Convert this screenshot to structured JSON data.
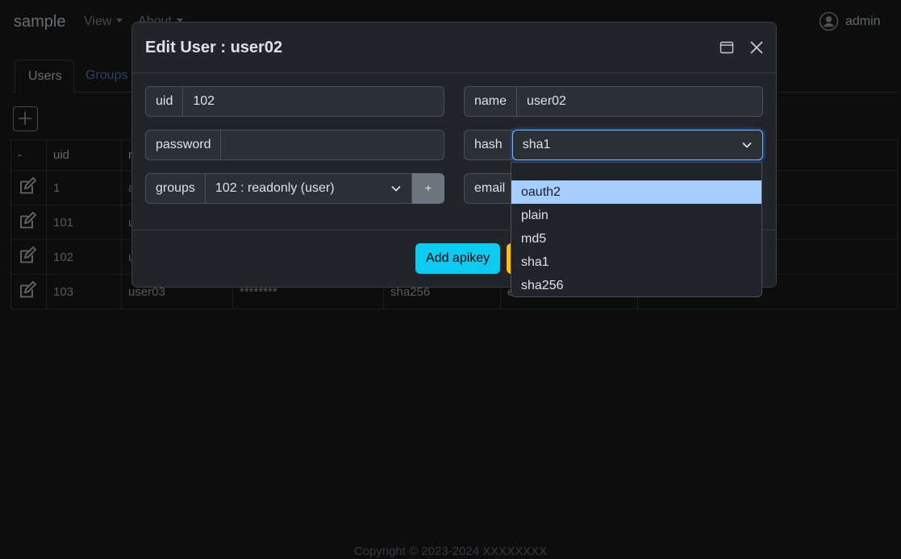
{
  "navbar": {
    "brand": "sample",
    "menu": [
      "View",
      "About"
    ],
    "user": "admin"
  },
  "tabs": [
    "Users",
    "Groups"
  ],
  "table": {
    "headers": [
      "-",
      "uid",
      "n"
    ],
    "rows": [
      {
        "uid": "1",
        "name": "a",
        "password": "",
        "hash": "",
        "email": ""
      },
      {
        "uid": "101",
        "name": "u",
        "password": "",
        "hash": "",
        "email": ""
      },
      {
        "uid": "102",
        "name": "u",
        "password": "",
        "hash": "",
        "email": ""
      },
      {
        "uid": "103",
        "name": "user03",
        "password": "********",
        "hash": "sha256",
        "email": "e"
      }
    ]
  },
  "modal": {
    "title": "Edit User : user02",
    "fields": {
      "uid_label": "uid",
      "uid_value": "102",
      "name_label": "name",
      "name_value": "user02",
      "password_label": "password",
      "password_value": "",
      "hash_label": "hash",
      "hash_value": "sha1",
      "groups_label": "groups",
      "groups_value": "102 : readonly (user)",
      "groups_add": "+",
      "email_label": "email"
    },
    "buttons": {
      "add_apikey": "Add apikey"
    }
  },
  "hash_options": [
    "",
    "oauth2",
    "plain",
    "md5",
    "sha1",
    "sha256"
  ],
  "hash_highlighted": "oauth2",
  "footer": "Copyright © 2023-2024 XXXXXXXX",
  "colors": {
    "accent_info": "#0dcaf0",
    "warning": "#ffc107",
    "option_highlight": "#a6cdff",
    "focus": "#86b7fe"
  },
  "icons": [
    "caret-down-icon",
    "user-circle-icon",
    "plus-square-icon",
    "edit-icon",
    "window-maximize-icon",
    "close-icon",
    "chevron-down-icon"
  ]
}
